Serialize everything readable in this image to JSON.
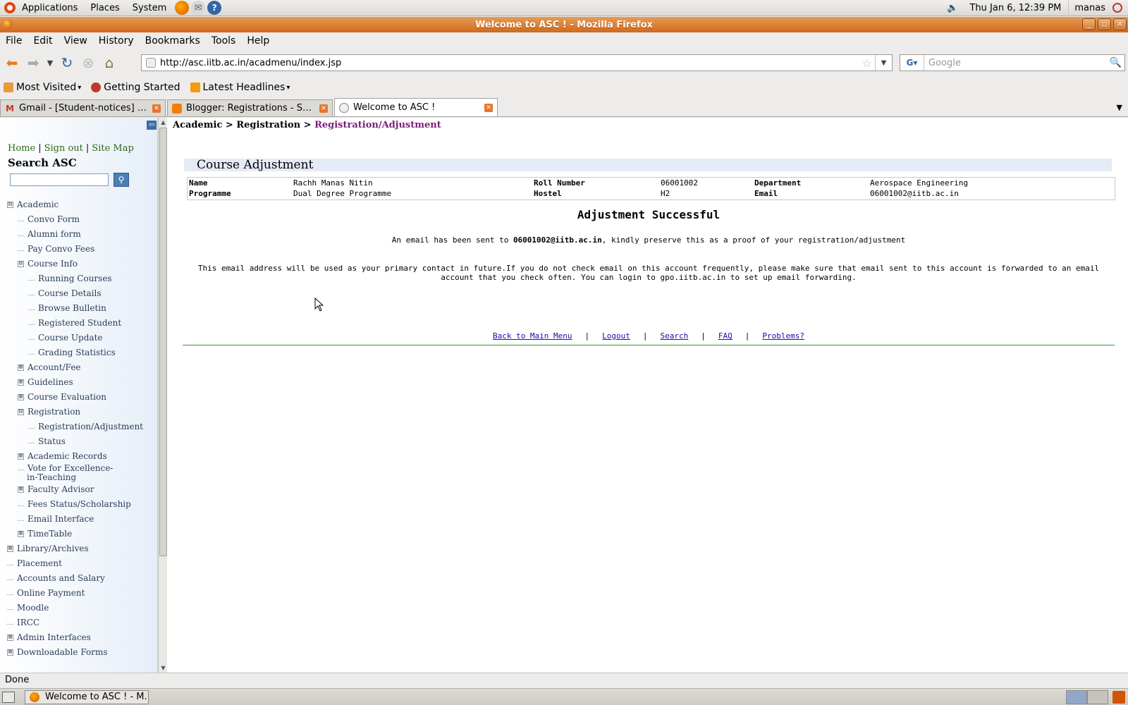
{
  "top_panel": {
    "menus": [
      "Applications",
      "Places",
      "System"
    ],
    "clock": "Thu Jan  6, 12:39 PM",
    "user": "manas"
  },
  "window": {
    "title": "Welcome to ASC ! - Mozilla Firefox"
  },
  "menubar": {
    "items": [
      "File",
      "Edit",
      "View",
      "History",
      "Bookmarks",
      "Tools",
      "Help"
    ]
  },
  "navbar": {
    "url": "http://asc.iitb.ac.in/acadmenu/index.jsp",
    "search_placeholder": "Google"
  },
  "bookmarks": {
    "items": [
      "Most Visited",
      "Getting Started",
      "Latest Headlines"
    ]
  },
  "tabs": [
    {
      "label": "Gmail - [Student-notices] Re..."
    },
    {
      "label": "Blogger: Registrations - Sprin..."
    },
    {
      "label": "Welcome to ASC !"
    }
  ],
  "sidebar": {
    "links": [
      "Home",
      "Sign out",
      "Site Map"
    ],
    "search_title": "Search ASC",
    "tree": [
      {
        "label": "Academic",
        "exp": "⊟"
      },
      {
        "label": "Convo Form"
      },
      {
        "label": "Alumni form"
      },
      {
        "label": "Pay Convo Fees"
      },
      {
        "label": "Course Info",
        "exp": "⊟"
      },
      {
        "label": "Running Courses"
      },
      {
        "label": "Course Details"
      },
      {
        "label": "Browse Bulletin"
      },
      {
        "label": "Registered Student"
      },
      {
        "label": "Course Update"
      },
      {
        "label": "Grading Statistics"
      },
      {
        "label": "Account/Fee",
        "exp": "⊞"
      },
      {
        "label": "Guidelines",
        "exp": "⊞"
      },
      {
        "label": "Course Evaluation",
        "exp": "⊞"
      },
      {
        "label": "Registration",
        "exp": "⊟"
      },
      {
        "label": "Registration/Adjustment"
      },
      {
        "label": "Status"
      },
      {
        "label": "Academic Records",
        "exp": "⊞"
      },
      {
        "label": "Vote for Excellence-"
      },
      {
        "label": "in-Teaching"
      },
      {
        "label": "Faculty Advisor",
        "exp": "⊞"
      },
      {
        "label": "Fees Status/Scholarship"
      },
      {
        "label": "Email Interface"
      },
      {
        "label": "TimeTable",
        "exp": "⊞"
      },
      {
        "label": "Library/Archives",
        "exp": "⊞"
      },
      {
        "label": "Placement"
      },
      {
        "label": "Accounts and Salary"
      },
      {
        "label": "Online Payment"
      },
      {
        "label": "Moodle"
      },
      {
        "label": "IRCC"
      },
      {
        "label": "Admin Interfaces",
        "exp": "⊞"
      },
      {
        "label": "Downloadable Forms",
        "exp": "⊞"
      }
    ]
  },
  "main": {
    "breadcrumb_prefix": "Academic > Registration > ",
    "breadcrumb_current": "Registration/Adjustment",
    "section_title": "Course Adjustment",
    "info": {
      "name_label": "Name",
      "name": "Rachh Manas Nitin",
      "roll_label": "Roll Number",
      "roll": "06001002",
      "dept_label": "Department",
      "dept": "Aerospace Engineering",
      "prog_label": "Programme",
      "prog": "Dual Degree Programme",
      "hostel_label": "Hostel",
      "hostel": "H2",
      "email_label": "Email",
      "email": "06001002@iitb.ac.in"
    },
    "success_title": "Adjustment Successful",
    "email_note_pre": "An email has been sent to ",
    "email_note_addr": "06001002@iitb.ac.in",
    "email_note_post": ", kindly preserve this as a proof of your registration/adjustment",
    "primary_note": "This email address will be used as your primary contact in future.If you do not check email on this account frequently, please make sure that email sent to this account is forwarded to an email account that you check often. You can login to gpo.iitb.ac.in to set up email forwarding.",
    "footer_links": [
      "Back to Main Menu",
      "Logout",
      "Search",
      "FAQ",
      "Problems?"
    ]
  },
  "status": "Done",
  "taskbar": {
    "window_button": "Welcome to ASC ! - M..."
  }
}
